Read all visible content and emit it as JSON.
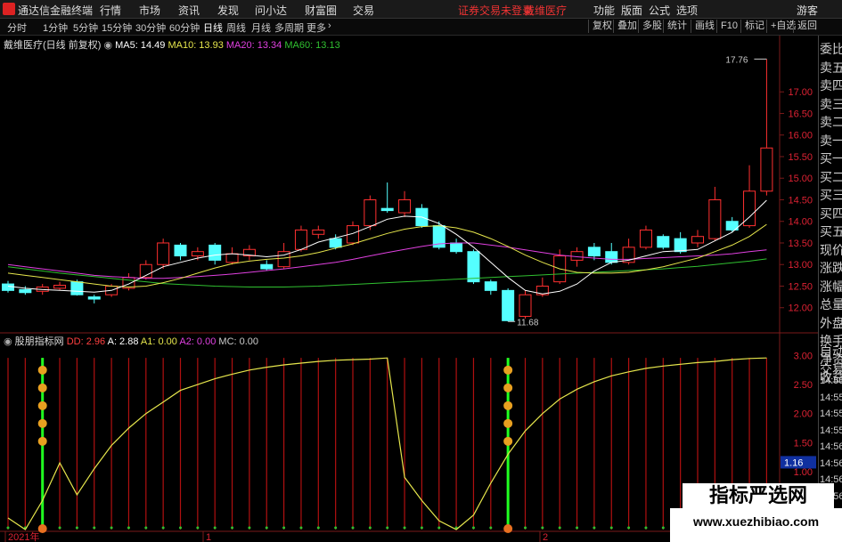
{
  "menubar": {
    "app_name": "通达信金融终端",
    "items": [
      "行情",
      "市场",
      "资讯",
      "发现",
      "问小达",
      "财富圈",
      "交易"
    ],
    "notice": "证券交易未登录",
    "stock_name": "戴维医疗",
    "right_items": [
      "功能",
      "版面",
      "公式",
      "选项"
    ],
    "user": "游客"
  },
  "toolbar": {
    "periods": [
      "分时",
      "1分钟",
      "5分钟",
      "15分钟",
      "30分钟",
      "60分钟",
      "日线",
      "周线",
      "月线",
      "多周期",
      "更多"
    ],
    "active_period": "日线",
    "right_buttons": [
      "复权",
      "叠加",
      "多股",
      "统计",
      "画线",
      "F10",
      "标记",
      "+自选",
      "返回"
    ]
  },
  "main_chart": {
    "legend_title": "戴维医疗(日线 前复权)",
    "ma": [
      {
        "label": "MA5: 14.49",
        "color": "#ffffff"
      },
      {
        "label": "MA10: 13.93",
        "color": "#e6e64c"
      },
      {
        "label": "MA20: 13.34",
        "color": "#e040e0"
      },
      {
        "label": "MA60: 13.13",
        "color": "#30c030"
      }
    ],
    "high_label": "17.76",
    "low_label": "11.68",
    "price_axis": [
      "17.00",
      "16.50",
      "16.00",
      "15.50",
      "15.00",
      "14.50",
      "14.00",
      "13.50",
      "13.00",
      "12.50",
      "12.00"
    ]
  },
  "indicator": {
    "name": "股朋指标网",
    "values": [
      {
        "label": "DD: 2.96",
        "color": "#ff4040"
      },
      {
        "label": "A: 2.88",
        "color": "#ffffff"
      },
      {
        "label": "A1: 0.00",
        "color": "#e6e64c"
      },
      {
        "label": "A2: 0.00",
        "color": "#e040e0"
      },
      {
        "label": "MC: 0.00",
        "color": "#cccccc"
      }
    ],
    "axis": [
      "3.00",
      "2.50",
      "2.00",
      "1.50",
      "1.00",
      "0.50"
    ],
    "current_value": "1.16"
  },
  "date_axis": [
    "2021年",
    "1",
    "2"
  ],
  "right_panel": {
    "labels": [
      "委比",
      "卖五",
      "卖四",
      "卖三",
      "卖二",
      "卖一",
      "买一",
      "买二",
      "买三",
      "买四",
      "买五",
      "现价",
      "涨跌",
      "涨幅",
      "总量",
      "外盘",
      "换手",
      "净资",
      "收益",
      "自动",
      "交易"
    ],
    "times": [
      "14:55",
      "14:55",
      "14:55",
      "14:55",
      "14:56",
      "14:56",
      "14:56",
      "14:56",
      "14:56",
      "14:56"
    ]
  },
  "watermark": {
    "title": "指标严选网",
    "url": "www.xuezhibiao.com"
  },
  "chart_data": {
    "type": "candlestick",
    "ohlc": [
      [
        12.55,
        12.4,
        12.62,
        12.35
      ],
      [
        12.42,
        12.35,
        12.5,
        12.3
      ],
      [
        12.38,
        12.48,
        12.55,
        12.3
      ],
      [
        12.45,
        12.52,
        12.6,
        12.4
      ],
      [
        12.6,
        12.3,
        12.65,
        12.28
      ],
      [
        12.25,
        12.2,
        12.3,
        12.1
      ],
      [
        12.3,
        12.5,
        12.55,
        12.25
      ],
      [
        12.45,
        12.7,
        12.8,
        12.4
      ],
      [
        12.7,
        13.0,
        13.1,
        12.65
      ],
      [
        13.0,
        13.5,
        13.6,
        12.9
      ],
      [
        13.45,
        13.2,
        13.5,
        13.1
      ],
      [
        13.2,
        13.3,
        13.4,
        13.1
      ],
      [
        13.45,
        13.1,
        13.5,
        13.0
      ],
      [
        13.05,
        13.25,
        13.4,
        13.0
      ],
      [
        13.2,
        13.35,
        13.45,
        13.1
      ],
      [
        13.0,
        12.9,
        13.1,
        12.85
      ],
      [
        12.95,
        13.3,
        13.5,
        12.9
      ],
      [
        13.35,
        13.8,
        13.9,
        13.3
      ],
      [
        13.7,
        13.8,
        13.9,
        13.6
      ],
      [
        13.6,
        13.4,
        13.7,
        13.35
      ],
      [
        13.5,
        13.9,
        14.0,
        13.45
      ],
      [
        13.9,
        14.5,
        14.6,
        13.8
      ],
      [
        14.3,
        14.25,
        14.9,
        14.2
      ],
      [
        14.2,
        14.5,
        14.7,
        14.1
      ],
      [
        14.3,
        13.9,
        14.4,
        13.85
      ],
      [
        13.9,
        13.4,
        14.0,
        13.35
      ],
      [
        13.5,
        13.3,
        13.6,
        13.25
      ],
      [
        13.3,
        12.6,
        13.35,
        12.55
      ],
      [
        12.6,
        12.4,
        12.65,
        12.3
      ],
      [
        12.4,
        11.7,
        12.45,
        11.68
      ],
      [
        11.8,
        12.3,
        12.4,
        11.75
      ],
      [
        12.3,
        12.5,
        12.7,
        12.25
      ],
      [
        12.6,
        13.2,
        13.35,
        12.55
      ],
      [
        13.1,
        13.3,
        13.4,
        12.95
      ],
      [
        13.4,
        13.2,
        13.5,
        13.1
      ],
      [
        13.3,
        13.05,
        13.5,
        13.0
      ],
      [
        13.05,
        13.4,
        13.6,
        13.0
      ],
      [
        13.4,
        13.8,
        13.9,
        13.35
      ],
      [
        13.65,
        13.4,
        13.7,
        13.35
      ],
      [
        13.6,
        13.3,
        13.75,
        13.25
      ],
      [
        13.5,
        13.65,
        13.8,
        13.4
      ],
      [
        13.6,
        14.5,
        14.8,
        13.55
      ],
      [
        14.0,
        13.8,
        14.1,
        13.75
      ],
      [
        13.9,
        14.7,
        15.3,
        13.85
      ],
      [
        14.7,
        15.7,
        17.76,
        14.6
      ]
    ],
    "ma5": [
      12.5,
      12.45,
      12.42,
      12.4,
      12.38,
      12.36,
      12.4,
      12.55,
      12.75,
      12.95,
      13.05,
      13.15,
      13.22,
      13.25,
      13.22,
      13.18,
      13.22,
      13.35,
      13.52,
      13.62,
      13.72,
      13.88,
      14.05,
      14.12,
      14.1,
      13.95,
      13.7,
      13.4,
      13.05,
      12.7,
      12.4,
      12.32,
      12.38,
      12.55,
      12.85,
      13.05,
      13.1,
      13.2,
      13.3,
      13.32,
      13.35,
      13.55,
      13.75,
      14.1,
      14.49
    ],
    "ma10": [
      12.8,
      12.75,
      12.7,
      12.65,
      12.6,
      12.55,
      12.5,
      12.48,
      12.5,
      12.58,
      12.68,
      12.8,
      12.92,
      13.02,
      13.08,
      13.12,
      13.15,
      13.2,
      13.28,
      13.38,
      13.48,
      13.6,
      13.72,
      13.82,
      13.88,
      13.9,
      13.85,
      13.75,
      13.6,
      13.42,
      13.22,
      13.05,
      12.9,
      12.82,
      12.8,
      12.8,
      12.82,
      12.88,
      12.95,
      13.05,
      13.15,
      13.3,
      13.45,
      13.65,
      13.93
    ],
    "ma20": [
      13.0,
      12.95,
      12.9,
      12.85,
      12.8,
      12.75,
      12.72,
      12.7,
      12.68,
      12.68,
      12.7,
      12.72,
      12.75,
      12.78,
      12.82,
      12.86,
      12.9,
      12.95,
      13.0,
      13.05,
      13.12,
      13.2,
      13.28,
      13.35,
      13.42,
      13.48,
      13.5,
      13.5,
      13.45,
      13.4,
      13.34,
      13.28,
      13.22,
      13.18,
      13.15,
      13.12,
      13.12,
      13.14,
      13.16,
      13.18,
      13.2,
      13.22,
      13.25,
      13.3,
      13.34
    ],
    "ma60": [
      12.95,
      12.9,
      12.85,
      12.8,
      12.76,
      12.72,
      12.68,
      12.64,
      12.6,
      12.56,
      12.54,
      12.52,
      12.5,
      12.49,
      12.48,
      12.48,
      12.48,
      12.49,
      12.5,
      12.52,
      12.54,
      12.56,
      12.58,
      12.6,
      12.62,
      12.64,
      12.66,
      12.68,
      12.7,
      12.72,
      12.74,
      12.76,
      12.78,
      12.8,
      12.82,
      12.84,
      12.86,
      12.88,
      12.9,
      12.93,
      12.96,
      13.0,
      13.04,
      13.08,
      13.13
    ],
    "ylim": [
      11.5,
      18.2
    ],
    "indicator_line": [
      0.2,
      0.0,
      0.5,
      1.15,
      0.6,
      1.05,
      1.45,
      1.75,
      2.0,
      2.2,
      2.4,
      2.5,
      2.6,
      2.68,
      2.75,
      2.8,
      2.84,
      2.87,
      2.9,
      2.92,
      2.93,
      2.94,
      2.96,
      0.9,
      0.5,
      0.15,
      0.0,
      0.25,
      0.8,
      1.3,
      1.7,
      2.0,
      2.25,
      2.42,
      2.55,
      2.65,
      2.72,
      2.78,
      2.82,
      2.85,
      2.88,
      2.9,
      2.93,
      2.95,
      2.96
    ],
    "indicator_ylim": [
      0,
      3.3
    ]
  }
}
